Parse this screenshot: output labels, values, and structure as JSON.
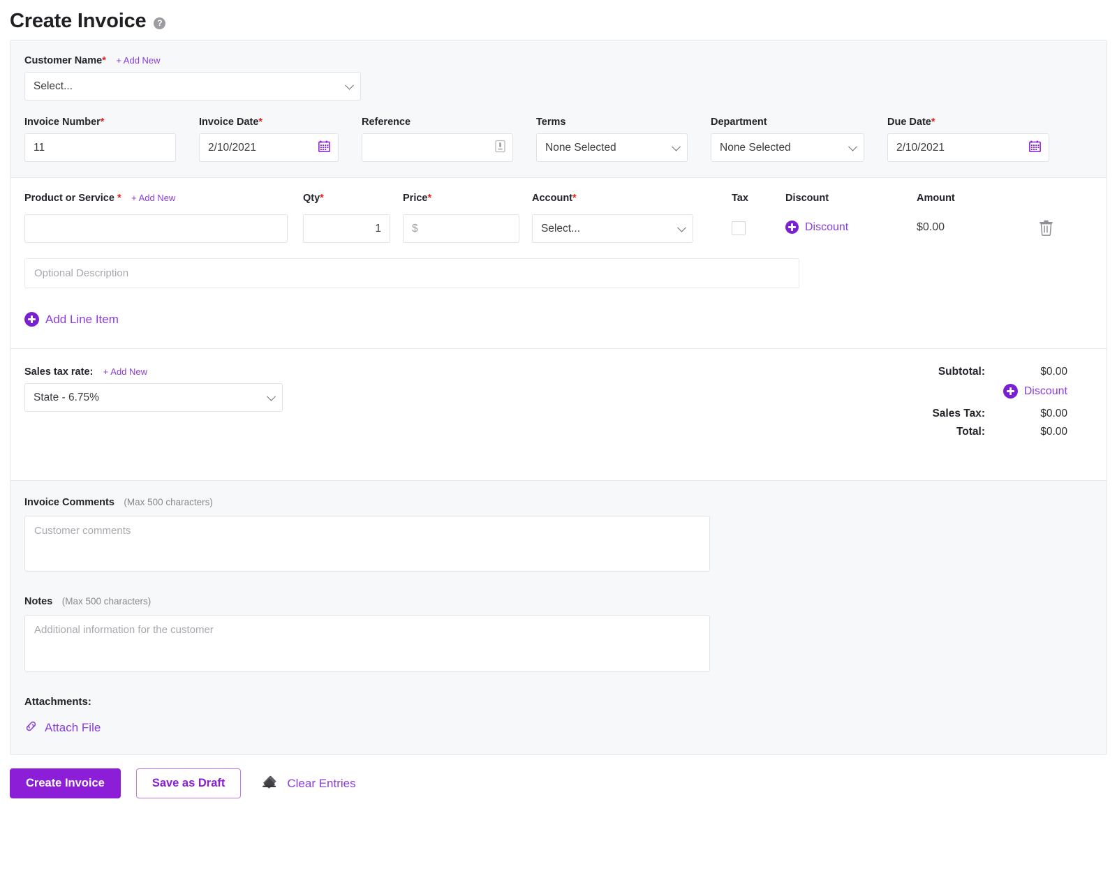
{
  "header": {
    "title": "Create Invoice",
    "help_icon": "help-circle-icon",
    "help_glyph": "?"
  },
  "customer": {
    "label": "Customer Name",
    "required_mark": "*",
    "add_new": "+ Add New",
    "select_value": "Select...",
    "chevron_icon": "chevron-down-icon"
  },
  "invoice_fields": {
    "invoice_number": {
      "label": "Invoice Number",
      "required_mark": "*",
      "value": "11"
    },
    "invoice_date": {
      "label": "Invoice Date",
      "required_mark": "*",
      "value": "2/10/2021",
      "icon": "calendar-icon"
    },
    "reference": {
      "label": "Reference",
      "value": "",
      "icon": "note-icon"
    },
    "terms": {
      "label": "Terms",
      "value": "None Selected",
      "icon": "chevron-down-icon"
    },
    "department": {
      "label": "Department",
      "value": "None Selected",
      "icon": "chevron-down-icon"
    },
    "due_date": {
      "label": "Due Date",
      "required_mark": "*",
      "value": "2/10/2021",
      "icon": "calendar-icon"
    }
  },
  "line_items": {
    "headers": {
      "product": "Product or Service",
      "product_required": "*",
      "product_add_new": "+ Add New",
      "qty": "Qty",
      "qty_required": "*",
      "price": "Price",
      "price_required": "*",
      "account": "Account",
      "account_required": "*",
      "tax": "Tax",
      "discount": "Discount",
      "amount": "Amount"
    },
    "row": {
      "product_value": "",
      "qty_value": "1",
      "price_placeholder": "$",
      "account_value": "Select...",
      "tax_checked": false,
      "discount_link": "Discount",
      "amount_value": "$0.00",
      "delete_icon": "trash-icon"
    },
    "description_placeholder": "Optional Description",
    "add_line_item": "Add Line Item"
  },
  "tax_section": {
    "label": "Sales tax rate:",
    "add_new": "+ Add New",
    "selected": "State - 6.75%"
  },
  "totals": {
    "subtotal_label": "Subtotal:",
    "subtotal_value": "$0.00",
    "discount_link": "Discount",
    "sales_tax_label": "Sales Tax:",
    "sales_tax_value": "$0.00",
    "total_label": "Total:",
    "total_value": "$0.00"
  },
  "comments": {
    "label": "Invoice Comments",
    "max_note": "(Max 500 characters)",
    "placeholder": "Customer comments"
  },
  "notes": {
    "label": "Notes",
    "max_note": "(Max 500 characters)",
    "placeholder": "Additional information for the customer"
  },
  "attachments": {
    "label": "Attachments:",
    "attach_link": "Attach File",
    "icon": "link-chain-icon"
  },
  "footer": {
    "create_invoice": "Create Invoice",
    "save_as_draft": "Save as Draft",
    "clear_entries": "Clear Entries",
    "clear_icon": "eraser-icon"
  },
  "colors": {
    "accent_purple": "#8b1ed6",
    "link_purple": "#8b3ddb",
    "required_red": "#e02020",
    "section_grey": "#f7f8fa"
  }
}
